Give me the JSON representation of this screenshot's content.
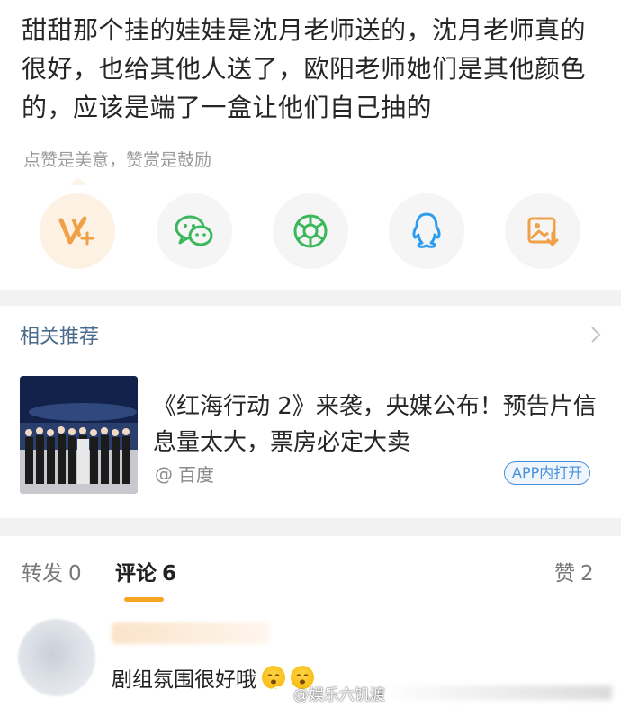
{
  "post": {
    "text": "甜甜那个挂的娃娃是沈月老师送的，沈月老师真的很好，也给其他人送了，欧阳老师她们是其他颜色的，应该是端了一盒让他们自己抽的",
    "reward_hint": "点赞是美意，赞赏是鼓励"
  },
  "share": {
    "items": [
      {
        "icon": "v-plus-icon",
        "color": "#f0a046"
      },
      {
        "icon": "wechat-icon",
        "color": "#3cb85c"
      },
      {
        "icon": "moments-icon",
        "color": "#3cb85c"
      },
      {
        "icon": "qq-icon",
        "color": "#2b9cf0"
      },
      {
        "icon": "save-image-icon",
        "color": "#f0a046"
      }
    ]
  },
  "recommend": {
    "title": "相关推荐",
    "headline": "《红海行动 2》来袭，央媒公布！预告片信息量太大，票房必定大卖",
    "source": "百度",
    "app_button": "APP内打开"
  },
  "tabs": {
    "repost_label": "转发",
    "repost_count": "0",
    "comment_label": "评论",
    "comment_count": "6",
    "like_label": "赞",
    "like_count": "2"
  },
  "comment": {
    "text": "剧组氛围很好哦"
  },
  "watermark": {
    "text": "@娱乐六饥渡"
  },
  "colors": {
    "accent": "#f6a623",
    "link": "#4a6b8c",
    "app_button": "#4a90d9"
  }
}
